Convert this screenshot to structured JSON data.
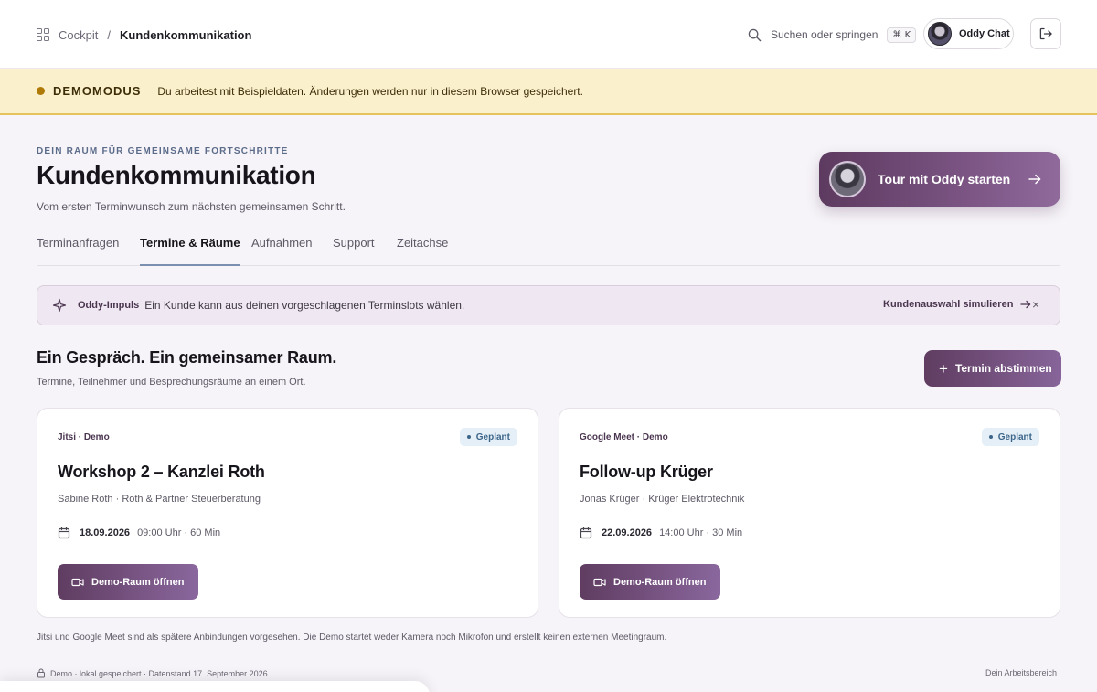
{
  "breadcrumb": {
    "root": "Cockpit",
    "separator": "/",
    "current": "Kundenkommunikation"
  },
  "search": {
    "label": "Suchen oder springen",
    "shortcut": "⌘ K"
  },
  "chat_button": {
    "label": "Oddy Chat"
  },
  "banner": {
    "tag": "DEMOMODUS",
    "message": "Du arbeitest mit Beispieldaten. Änderungen werden nur in diesem Browser gespeichert."
  },
  "header": {
    "eyebrow": "DEIN RAUM FÜR GEMEINSAME FORTSCHRITTE",
    "title": "Kundenkommunikation",
    "subtitle": "Vom ersten Terminwunsch zum nächsten gemeinsamen Schritt."
  },
  "tour_button": {
    "label": "Tour mit Oddy starten"
  },
  "tabs": [
    {
      "label": "Terminanfragen"
    },
    {
      "label": "Termine & Räume"
    },
    {
      "label": "Aufnahmen"
    },
    {
      "label": "Support"
    },
    {
      "label": "Zeitachse"
    }
  ],
  "impulse": {
    "title": "Oddy-Impuls",
    "text": "Ein Kunde kann aus deinen vorgeschlagenen Terminslots wählen.",
    "action": "Kundenauswahl simulieren",
    "close": "×"
  },
  "section": {
    "title": "Ein Gespräch. Ein gemeinsamer Raum.",
    "subtitle": "Termine, Teilnehmer und Besprechungsräume an einem Ort.",
    "new_button": "Termin abstimmen"
  },
  "meetings": [
    {
      "provider": "Jitsi · Demo",
      "status": "Geplant",
      "title": "Workshop 2 – Kanzlei Roth",
      "participants": "Sabine Roth · Roth & Partner Steuerberatung",
      "date": "18.09.2026",
      "time": "09:00 Uhr · 60 Min",
      "button": "Demo-Raum öffnen"
    },
    {
      "provider": "Google Meet · Demo",
      "status": "Geplant",
      "title": "Follow-up Krüger",
      "participants": "Jonas Krüger · Krüger Elektrotechnik",
      "date": "22.09.2026",
      "time": "14:00 Uhr · 30 Min",
      "button": "Demo-Raum öffnen"
    }
  ],
  "note": "Jitsi und Google Meet sind als spätere Anbindungen vorgesehen. Die Demo startet weder Kamera noch Mikrofon und erstellt keinen externen Meetingraum.",
  "footer": {
    "left": "Demo · lokal gespeichert · Datenstand 17. September 2026",
    "right": "Dein Arbeitsbereich"
  },
  "colors": {
    "accent": "#6b4770",
    "banner_bg": "#fbf0cc",
    "badge_bg": "#e5eff8"
  }
}
